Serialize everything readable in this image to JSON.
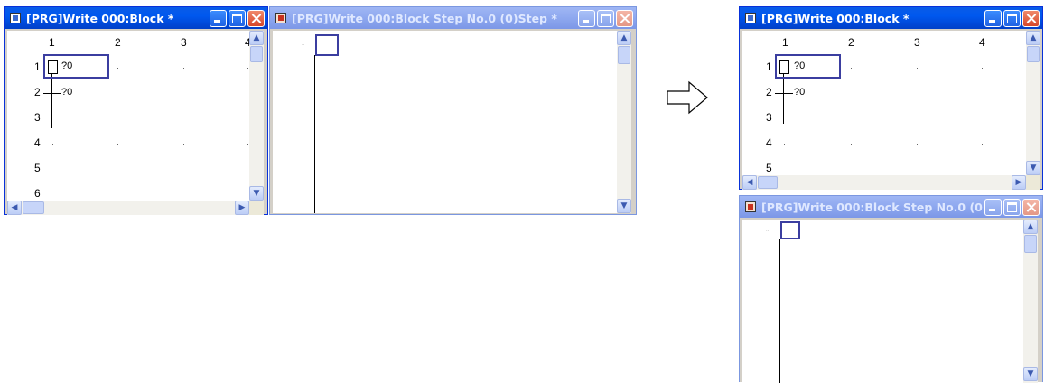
{
  "left_block_window": {
    "title": "[PRG]Write 000:Block *",
    "column_numbers": [
      "1",
      "2",
      "3",
      "4"
    ],
    "row_numbers": [
      "1",
      "2",
      "3",
      "4",
      "5",
      "6"
    ],
    "instructions": [
      "?0",
      "?0"
    ]
  },
  "left_step_window": {
    "title": "[PRG]Write 000:Block Step No.0 (0)Step *",
    "step_marker": "‥"
  },
  "arrow": {
    "icon": "right-arrow-icon"
  },
  "right_block_window": {
    "title": "[PRG]Write 000:Block *",
    "column_numbers": [
      "1",
      "2",
      "3",
      "4"
    ],
    "row_numbers": [
      "1",
      "2",
      "3",
      "4",
      "5"
    ],
    "instructions": [
      "?0",
      "?0"
    ]
  },
  "right_step_window": {
    "title": "[PRG]Write 000:Block Step No.0 (0)...",
    "step_marker": "‥"
  },
  "colors": {
    "titlebar_active": "#0058ee",
    "titlebar_inactive": "#8ea8ef",
    "cursor": "#3b3ea0"
  }
}
